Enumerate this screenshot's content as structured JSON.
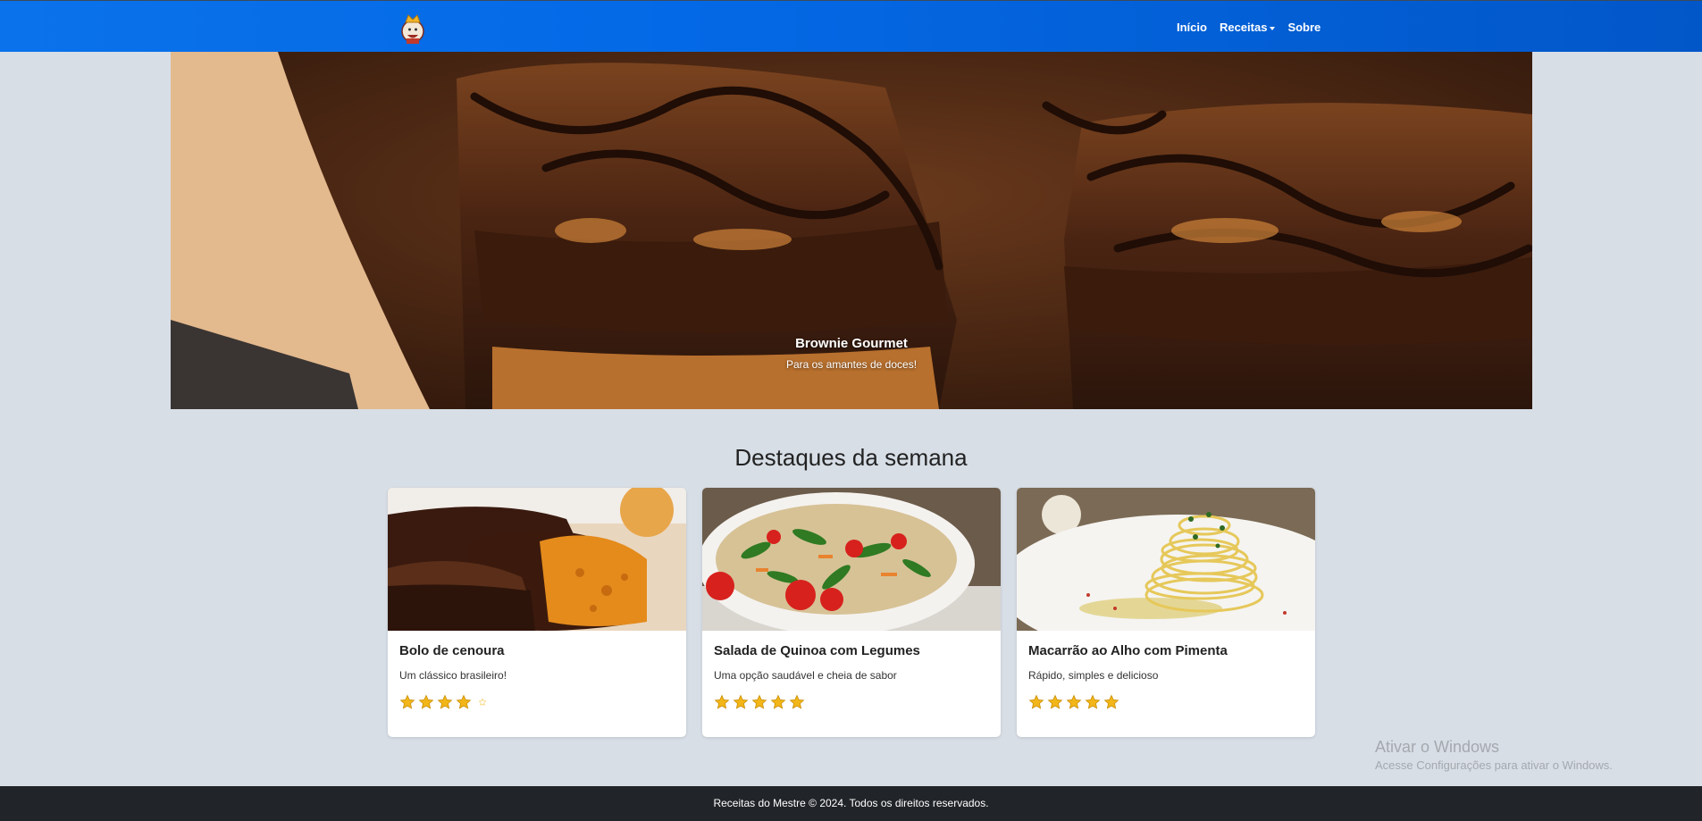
{
  "navbar": {
    "logo_icon": "chef-king-logo-icon",
    "links": {
      "home": "Início",
      "recipes": "Receitas",
      "about": "Sobre"
    }
  },
  "hero": {
    "title": "Brownie Gourmet",
    "subtitle": "Para os amantes de doces!"
  },
  "featured": {
    "title": "Destaques da semana",
    "cards": [
      {
        "title": "Bolo de cenoura",
        "description": "Um clássico brasileiro!",
        "rating": 4
      },
      {
        "title": "Salada de Quinoa com Legumes",
        "description": "Uma opção saudável e cheia de sabor",
        "rating": 5
      },
      {
        "title": "Macarrão ao Alho com Pimenta",
        "description": "Rápido, simples e delicioso",
        "rating": 5
      }
    ]
  },
  "watermark": {
    "title": "Ativar o Windows",
    "subtitle": "Acesse Configurações para ativar o Windows."
  },
  "footer": {
    "text": "Receitas do Mestre © 2024. Todos os direitos reservados."
  },
  "colors": {
    "navbar": "#0469e6",
    "footer": "#212529",
    "background": "#d7dee6",
    "star": "#f2b619"
  }
}
